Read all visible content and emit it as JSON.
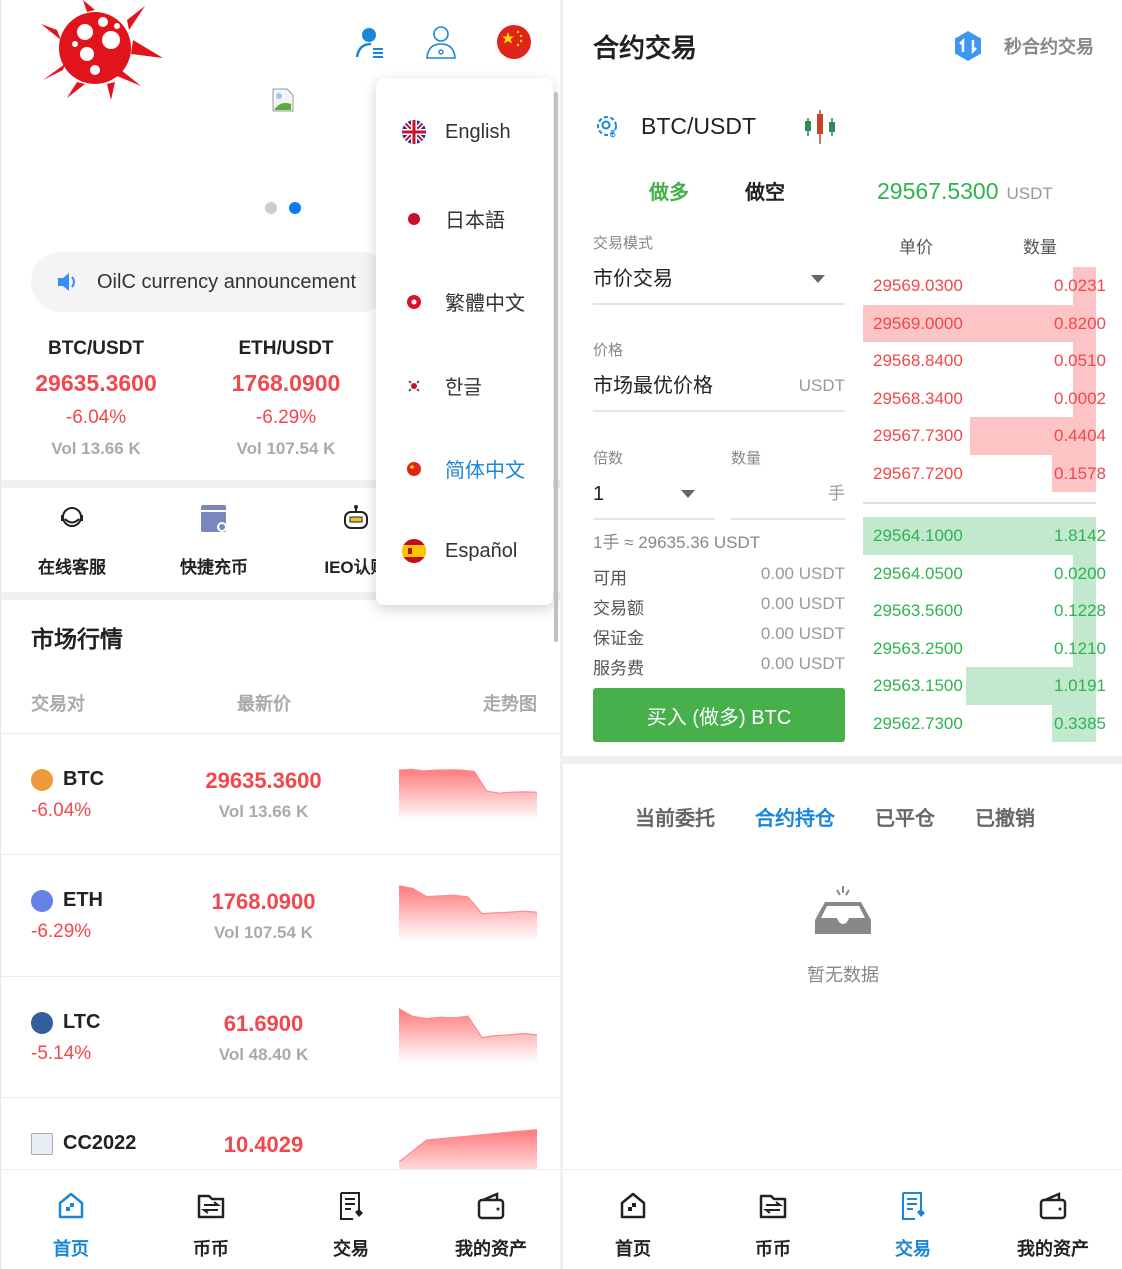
{
  "home": {
    "announcement": "OilC currency announcement",
    "carousel": {
      "count": 2,
      "active_index": 1
    },
    "tickers": [
      {
        "pair": "BTC/USDT",
        "price": "29635.3600",
        "change": "-6.04%",
        "volume": "Vol 13.66 K"
      },
      {
        "pair": "ETH/USDT",
        "price": "1768.0900",
        "change": "-6.29%",
        "volume": "Vol 107.54 K"
      }
    ],
    "quick_actions": [
      {
        "label": "在线客服",
        "icon": "headset-icon"
      },
      {
        "label": "快捷充币",
        "icon": "deposit-card-icon"
      },
      {
        "label": "IEO认购",
        "icon": "robot-icon"
      }
    ],
    "market": {
      "title": "市场行情",
      "headers": [
        "交易对",
        "最新价",
        "走势图"
      ],
      "rows": [
        {
          "symbol": "BTC",
          "change": "-6.04%",
          "price": "29635.3600",
          "volume": "Vol 13.66 K",
          "trend": [
            0.82,
            0.84,
            0.8,
            0.82,
            0.83,
            0.82,
            0.78,
            0.2,
            0.14,
            0.17,
            0.18,
            0.17
          ]
        },
        {
          "symbol": "ETH",
          "change": "-6.29%",
          "price": "1768.0900",
          "volume": "Vol 107.54 K",
          "trend": [
            0.98,
            0.9,
            0.66,
            0.68,
            0.7,
            0.65,
            0.16,
            0.18,
            0.2,
            0.23,
            0.2
          ]
        },
        {
          "symbol": "LTC",
          "change": "-5.14%",
          "price": "61.6900",
          "volume": "Vol 48.40 K",
          "trend": [
            0.95,
            0.72,
            0.66,
            0.7,
            0.68,
            0.73,
            0.1,
            0.16,
            0.18,
            0.22,
            0.18
          ]
        },
        {
          "symbol": "CC2022",
          "change": "",
          "price": "10.4029",
          "volume": "",
          "trend": [
            0.0,
            0.65,
            0.72,
            0.8,
            0.88,
            0.95
          ]
        }
      ]
    },
    "language_menu": {
      "items": [
        {
          "label": "English",
          "flag": "uk-flag-icon"
        },
        {
          "label": "日本語",
          "flag": "japan-flag-icon"
        },
        {
          "label": "繁體中文",
          "flag": "hongkong-flag-icon"
        },
        {
          "label": "한글",
          "flag": "korea-flag-icon"
        },
        {
          "label": "简体中文",
          "flag": "china-flag-icon",
          "active": true
        },
        {
          "label": "Español",
          "flag": "spain-flag-icon"
        }
      ]
    },
    "tabbar": [
      "首页",
      "币币",
      "交易",
      "我的资产"
    ],
    "active_tab": 0
  },
  "trade": {
    "title": "合约交易",
    "second_contract": "秒合约交易",
    "pair": "BTC/USDT",
    "side_long": "做多",
    "side_short": "做空",
    "last_price": "29567.5300",
    "last_price_unit": "USDT",
    "mode_label": "交易模式",
    "mode_value": "市价交易",
    "price_label": "价格",
    "price_value": "市场最优价格",
    "price_unit": "USDT",
    "multiplier_label": "倍数",
    "multiplier_value": "1",
    "quantity_label": "数量",
    "quantity_unit": "手",
    "lot_hint": "1手 ≈ 29635.36 USDT",
    "summary": [
      {
        "label": "可用",
        "value": "0.00 USDT"
      },
      {
        "label": "交易额",
        "value": "0.00 USDT"
      },
      {
        "label": "保证金",
        "value": "0.00 USDT"
      },
      {
        "label": "服务费",
        "value": "0.00 USDT"
      }
    ],
    "buy_button": "买入 (做多) BTC",
    "orderbook": {
      "headers": [
        "单价",
        "数量"
      ],
      "asks": [
        {
          "price": "29569.0300",
          "qty": "0.0231",
          "depth": 0.1
        },
        {
          "price": "29569.0000",
          "qty": "0.8200",
          "depth": 1.0
        },
        {
          "price": "29568.8400",
          "qty": "0.0510",
          "depth": 0.1
        },
        {
          "price": "29568.3400",
          "qty": "0.0002",
          "depth": 0.1
        },
        {
          "price": "29567.7300",
          "qty": "0.4404",
          "depth": 0.54
        },
        {
          "price": "29567.7200",
          "qty": "0.1578",
          "depth": 0.19
        }
      ],
      "bids": [
        {
          "price": "29564.1000",
          "qty": "1.8142",
          "depth": 1.0
        },
        {
          "price": "29564.0500",
          "qty": "0.0200",
          "depth": 0.1
        },
        {
          "price": "29563.5600",
          "qty": "0.1228",
          "depth": 0.1
        },
        {
          "price": "29563.2500",
          "qty": "0.1210",
          "depth": 0.1
        },
        {
          "price": "29563.1500",
          "qty": "1.0191",
          "depth": 0.56
        },
        {
          "price": "29562.7300",
          "qty": "0.3385",
          "depth": 0.19
        }
      ]
    },
    "order_tabs": [
      "当前委托",
      "合约持仓",
      "已平仓",
      "已撤销"
    ],
    "active_order_tab": 1,
    "empty_text": "暂无数据",
    "tabbar": [
      "首页",
      "币币",
      "交易",
      "我的资产"
    ],
    "active_tab": 2
  },
  "colors": {
    "up": "#2fb350",
    "down": "#f2474c",
    "accent": "#1a86d8",
    "buy": "#47b04b"
  }
}
